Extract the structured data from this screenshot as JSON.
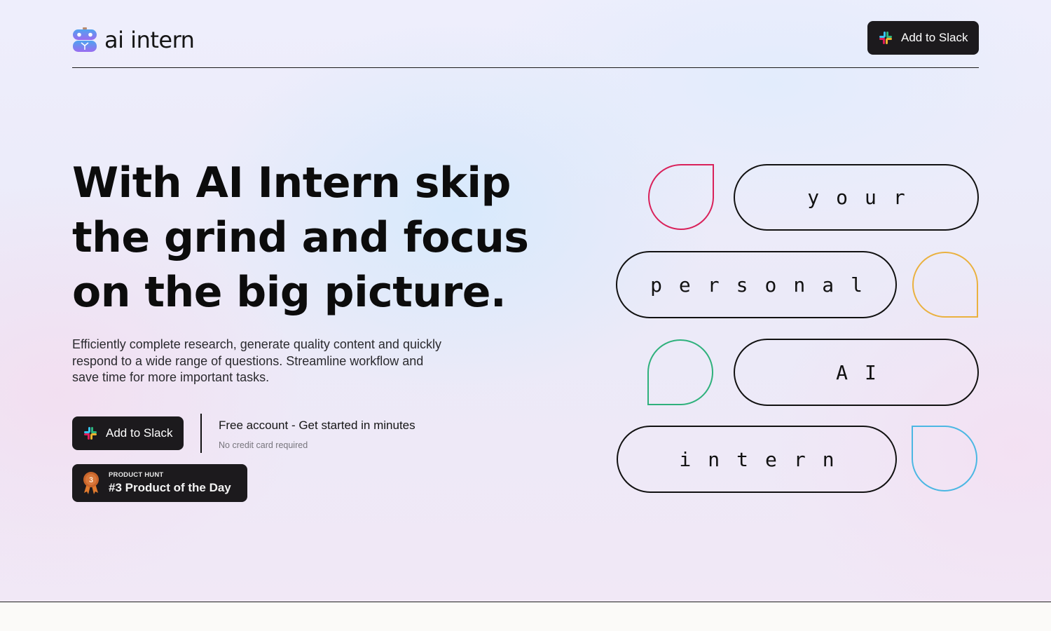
{
  "brand": {
    "name": "ai intern"
  },
  "header": {
    "cta_label": "Add to Slack"
  },
  "hero": {
    "headline": "With AI Intern skip the grind and focus on the big picture.",
    "subtext": "Efficiently complete research, generate quality content and quickly respond to a wide range of questions. Streamline workflow and save time for more important tasks.",
    "cta_label": "Add to Slack",
    "cta_main": "Free account - Get started in minutes",
    "cta_note": "No credit card required",
    "badge": {
      "eyebrow": "PRODUCT HUNT",
      "title": "#3 Product of the Day",
      "rank": "3"
    }
  },
  "words": [
    "your",
    "personal",
    "AI",
    "intern"
  ],
  "colors": {
    "dark": "#1c1a1d",
    "drop_red": "#d9215a",
    "drop_yellow": "#eab13f",
    "drop_green": "#2fb17c",
    "drop_blue": "#4bb7e3",
    "medal": "#c8642a"
  }
}
